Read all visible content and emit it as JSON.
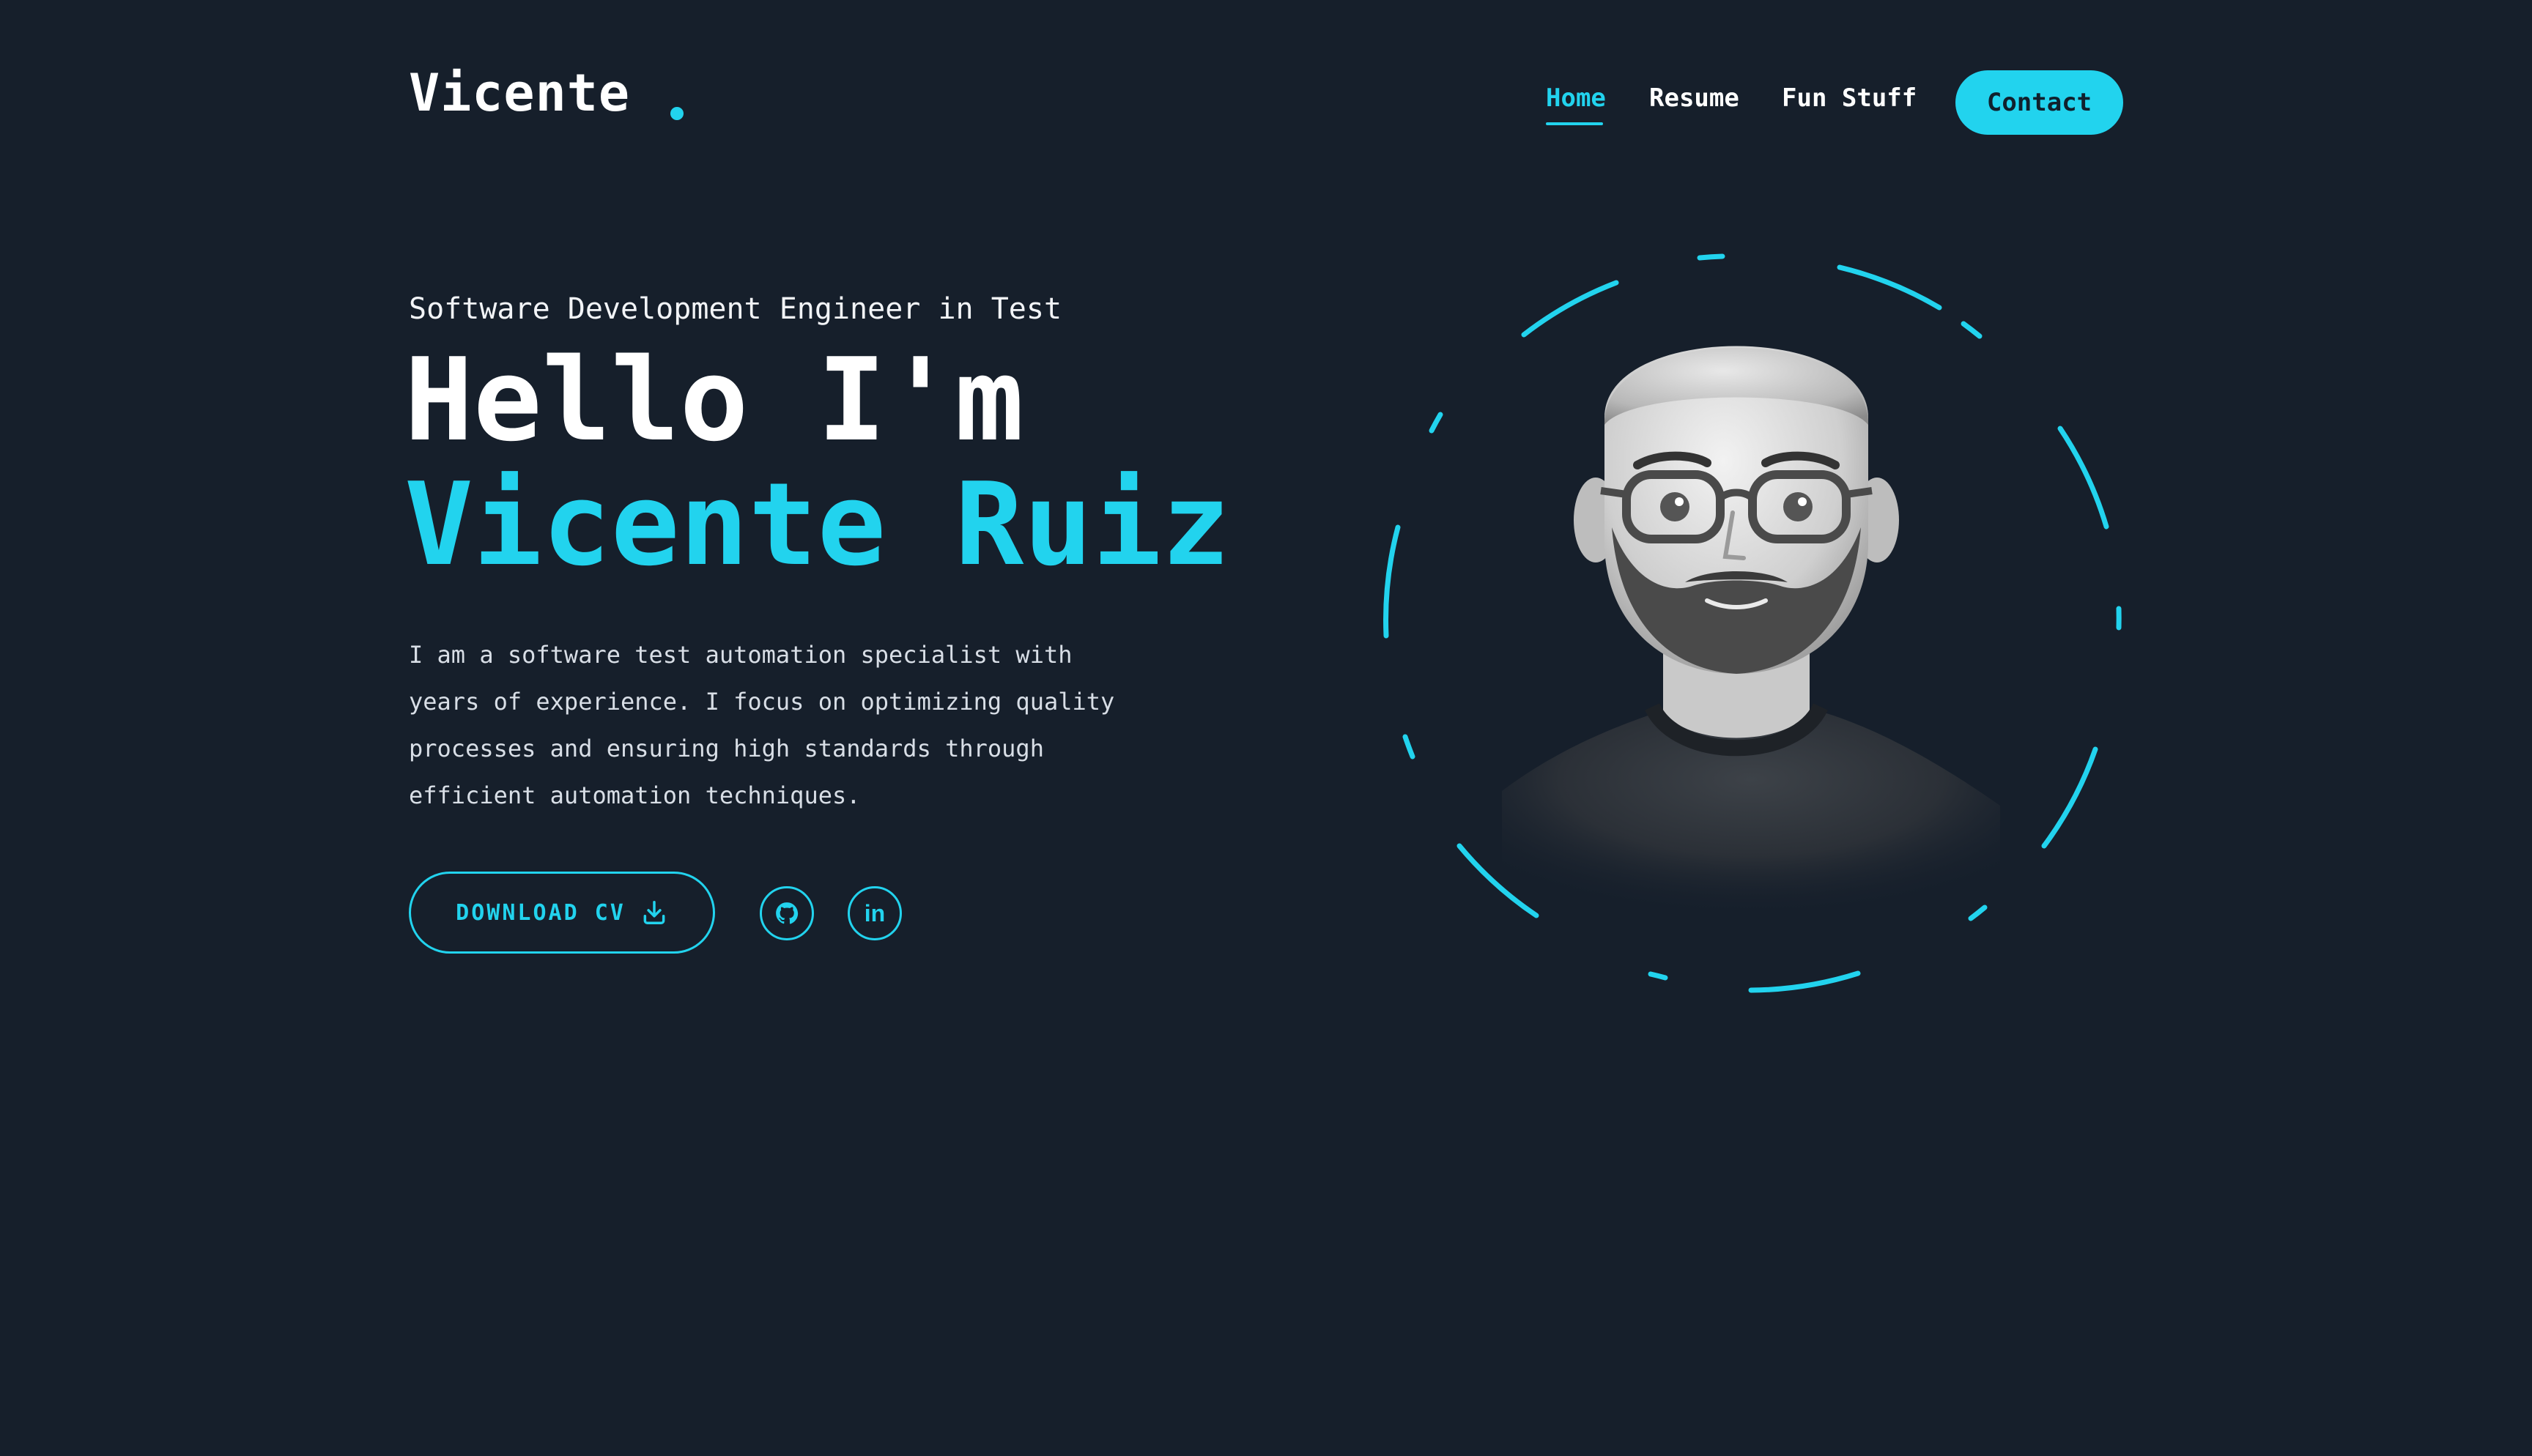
{
  "colors": {
    "background": "#161f2b",
    "accent": "#22d3ee",
    "text": "#ffffff"
  },
  "header": {
    "logo": "Vicente",
    "nav": {
      "home": "Home",
      "resume": "Resume",
      "fun_stuff": "Fun Stuff",
      "contact": "Contact"
    },
    "active_nav": "Home"
  },
  "hero": {
    "subtitle": "Software Development Engineer in Test",
    "greeting": "Hello I'm",
    "name": "Vicente Ruiz",
    "description_lines": [
      "I am a software test automation specialist with",
      "years of experience. I focus on optimizing quality",
      "processes and ensuring high standards through",
      "efficient automation techniques."
    ],
    "download_cv_label": "DOWNLOAD CV",
    "download_icon": "download-icon",
    "social": [
      {
        "name": "github",
        "icon": "github-icon"
      },
      {
        "name": "linkedin",
        "icon": "linkedin-icon",
        "glyph": "in"
      }
    ]
  },
  "avatar": {
    "icon": "avatar-illustration"
  }
}
